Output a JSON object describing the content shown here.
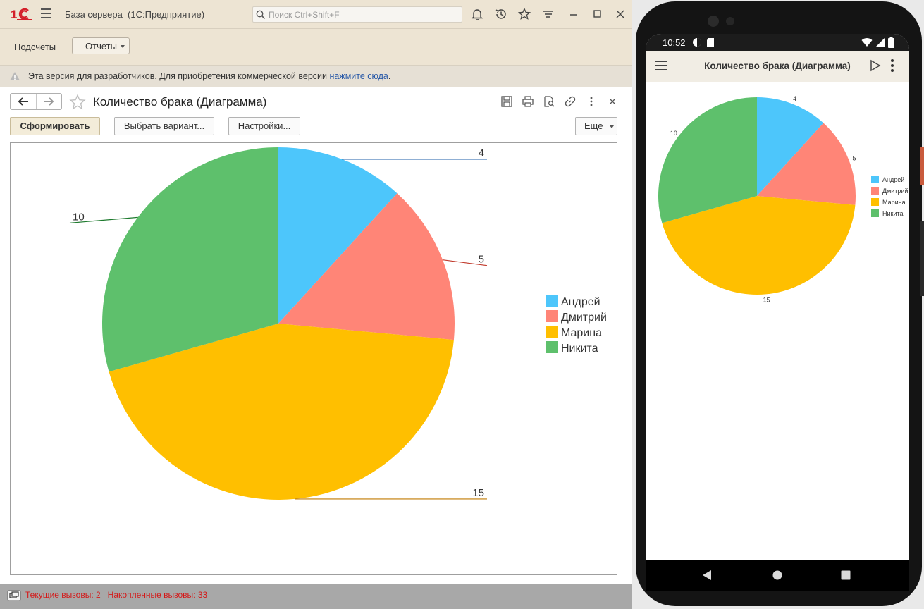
{
  "window": {
    "title": "База сервера  (1С:Предприятие)",
    "search_placeholder": "Поиск Ctrl+Shift+F"
  },
  "sections": {
    "podschety": "Подсчеты",
    "otchety": "Отчеты"
  },
  "warning": {
    "text": "Эта версия для разработчиков. Для приобретения коммерческой версии ",
    "link": "нажмите сюда",
    "tail": "."
  },
  "report": {
    "title": "Количество брака (Диаграмма)",
    "buttons": {
      "generate": "Сформировать",
      "choose_variant": "Выбрать вариант...",
      "settings": "Настройки...",
      "more": "Еще"
    }
  },
  "status": {
    "text": "Текущие вызовы: 2   Накопленные вызовы: 33"
  },
  "chart_data": {
    "type": "pie",
    "title": "",
    "categories": [
      "Андрей",
      "Дмитрий",
      "Марина",
      "Никита"
    ],
    "values": [
      4,
      5,
      15,
      10
    ],
    "colors": [
      "#4dc6fb",
      "#ff8577",
      "#ffbf00",
      "#5ec06c"
    ],
    "leader_colors": [
      "#1f5fa8",
      "#c0392b",
      "#c07a00",
      "#1e7a2e"
    ],
    "legend_position": "right",
    "start_angle": "12 o'clock, clockwise"
  },
  "mobile": {
    "time": "10:52",
    "title": "Количество брака (Диаграмма)"
  }
}
